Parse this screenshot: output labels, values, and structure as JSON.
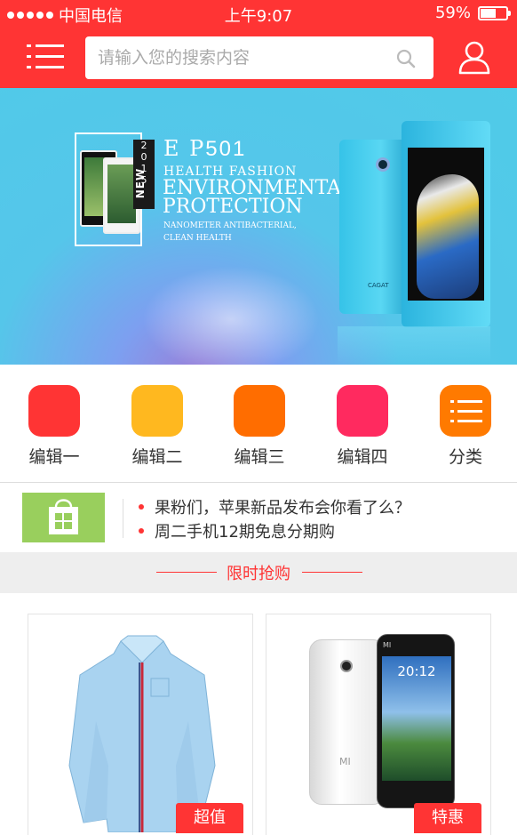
{
  "status_bar": {
    "carrier": "中国电信",
    "time": "上午9:07",
    "battery": "59%",
    "battery_level": 0.59
  },
  "header": {
    "search_placeholder": "请输入您的搜索内容"
  },
  "banner": {
    "model_prefix": "E P",
    "model_number": "501",
    "year_digits": [
      "2",
      "0",
      "1",
      "5"
    ],
    "new_tag": "NEW",
    "line1": "HEALTH   FASHION",
    "line2": "ENVIRONMENTAL",
    "line3": "PROTECTION",
    "line4": "NANOMETER ANTIBACTERIAL,",
    "line5": "CLEAN HEALTH",
    "phone_brand": "CAGAT"
  },
  "categories": [
    {
      "label": "编辑一",
      "color": "#ff3434"
    },
    {
      "label": "编辑二",
      "color": "#ffb81f"
    },
    {
      "label": "编辑三",
      "color": "#ff6d00"
    },
    {
      "label": "编辑四",
      "color": "#ff2a5f"
    },
    {
      "label": "分类",
      "color": "#ff7a00"
    }
  ],
  "news": [
    "果粉们，苹果新品发布会你看了么？",
    "周二手机12期免息分期购"
  ],
  "flash_sale": {
    "title": "限时抢购"
  },
  "products": [
    {
      "tag": "超值"
    },
    {
      "tag": "特惠",
      "screen_time": "20:12",
      "brand": "MI"
    }
  ]
}
